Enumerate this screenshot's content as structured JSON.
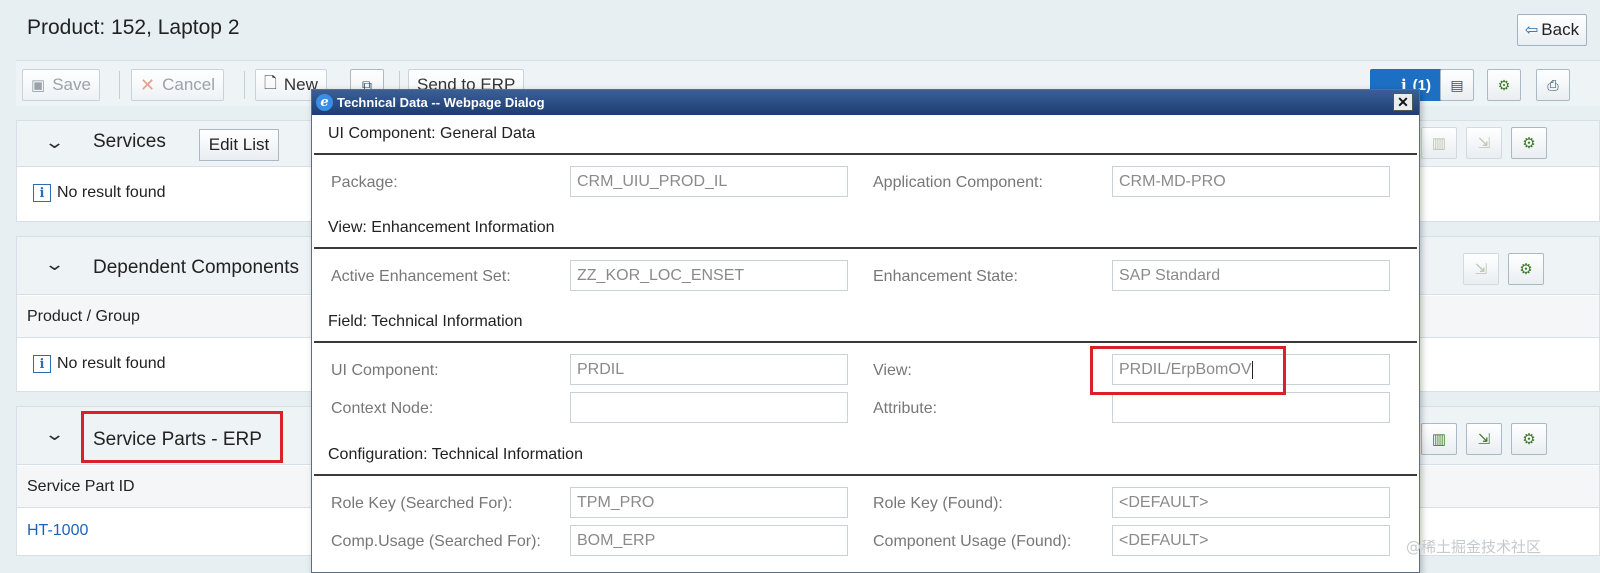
{
  "page": {
    "title": "Product: 152, Laptop 2",
    "back_label": "Back"
  },
  "toolbar": {
    "save_label": "Save",
    "cancel_label": "Cancel",
    "new_label": "New",
    "send_label": "Send to ERP",
    "messages_label": "(1)"
  },
  "blocks": {
    "services": {
      "title": "Services",
      "edit_list_label": "Edit List",
      "message": "No result found"
    },
    "dependent": {
      "title": "Dependent Components",
      "column": "Product / Group",
      "message": "No result found"
    },
    "service_parts": {
      "title": "Service Parts - ERP",
      "column": "Service Part ID",
      "row_value": "HT-1000"
    }
  },
  "dialog": {
    "title": "Technical Data -- Webpage Dialog",
    "sections": {
      "general": "UI Component: General Data",
      "enhancement": "View: Enhancement Information",
      "field": "Field: Technical Information",
      "configuration": "Configuration: Technical Information"
    },
    "fields": {
      "package": {
        "label": "Package:",
        "value": "CRM_UIU_PROD_IL"
      },
      "app_component": {
        "label": "Application Component:",
        "value": "CRM-MD-PRO"
      },
      "enh_set": {
        "label": "Active Enhancement Set:",
        "value": "ZZ_KOR_LOC_ENSET"
      },
      "enh_state": {
        "label": "Enhancement State:",
        "value": "SAP Standard"
      },
      "ui_component": {
        "label": "UI Component:",
        "value": "PRDIL"
      },
      "view": {
        "label": "View:",
        "value": "PRDIL/ErpBomOV"
      },
      "context_node": {
        "label": "Context Node:",
        "value": ""
      },
      "attribute": {
        "label": "Attribute:",
        "value": ""
      },
      "role_key_searched": {
        "label": "Role Key (Searched For):",
        "value": "TPM_PRO"
      },
      "role_key_found": {
        "label": "Role Key (Found):",
        "value": "<DEFAULT>"
      },
      "comp_usage_searched": {
        "label": "Comp.Usage (Searched For):",
        "value": "BOM_ERP"
      },
      "comp_usage_found": {
        "label": "Component Usage (Found):",
        "value": "<DEFAULT>"
      }
    }
  },
  "watermark": "@稀土掘金技术社区",
  "colors": {
    "highlight": "#d8212a",
    "link": "#1d63b5",
    "dialog_titlebar": "#1d3d6f"
  }
}
